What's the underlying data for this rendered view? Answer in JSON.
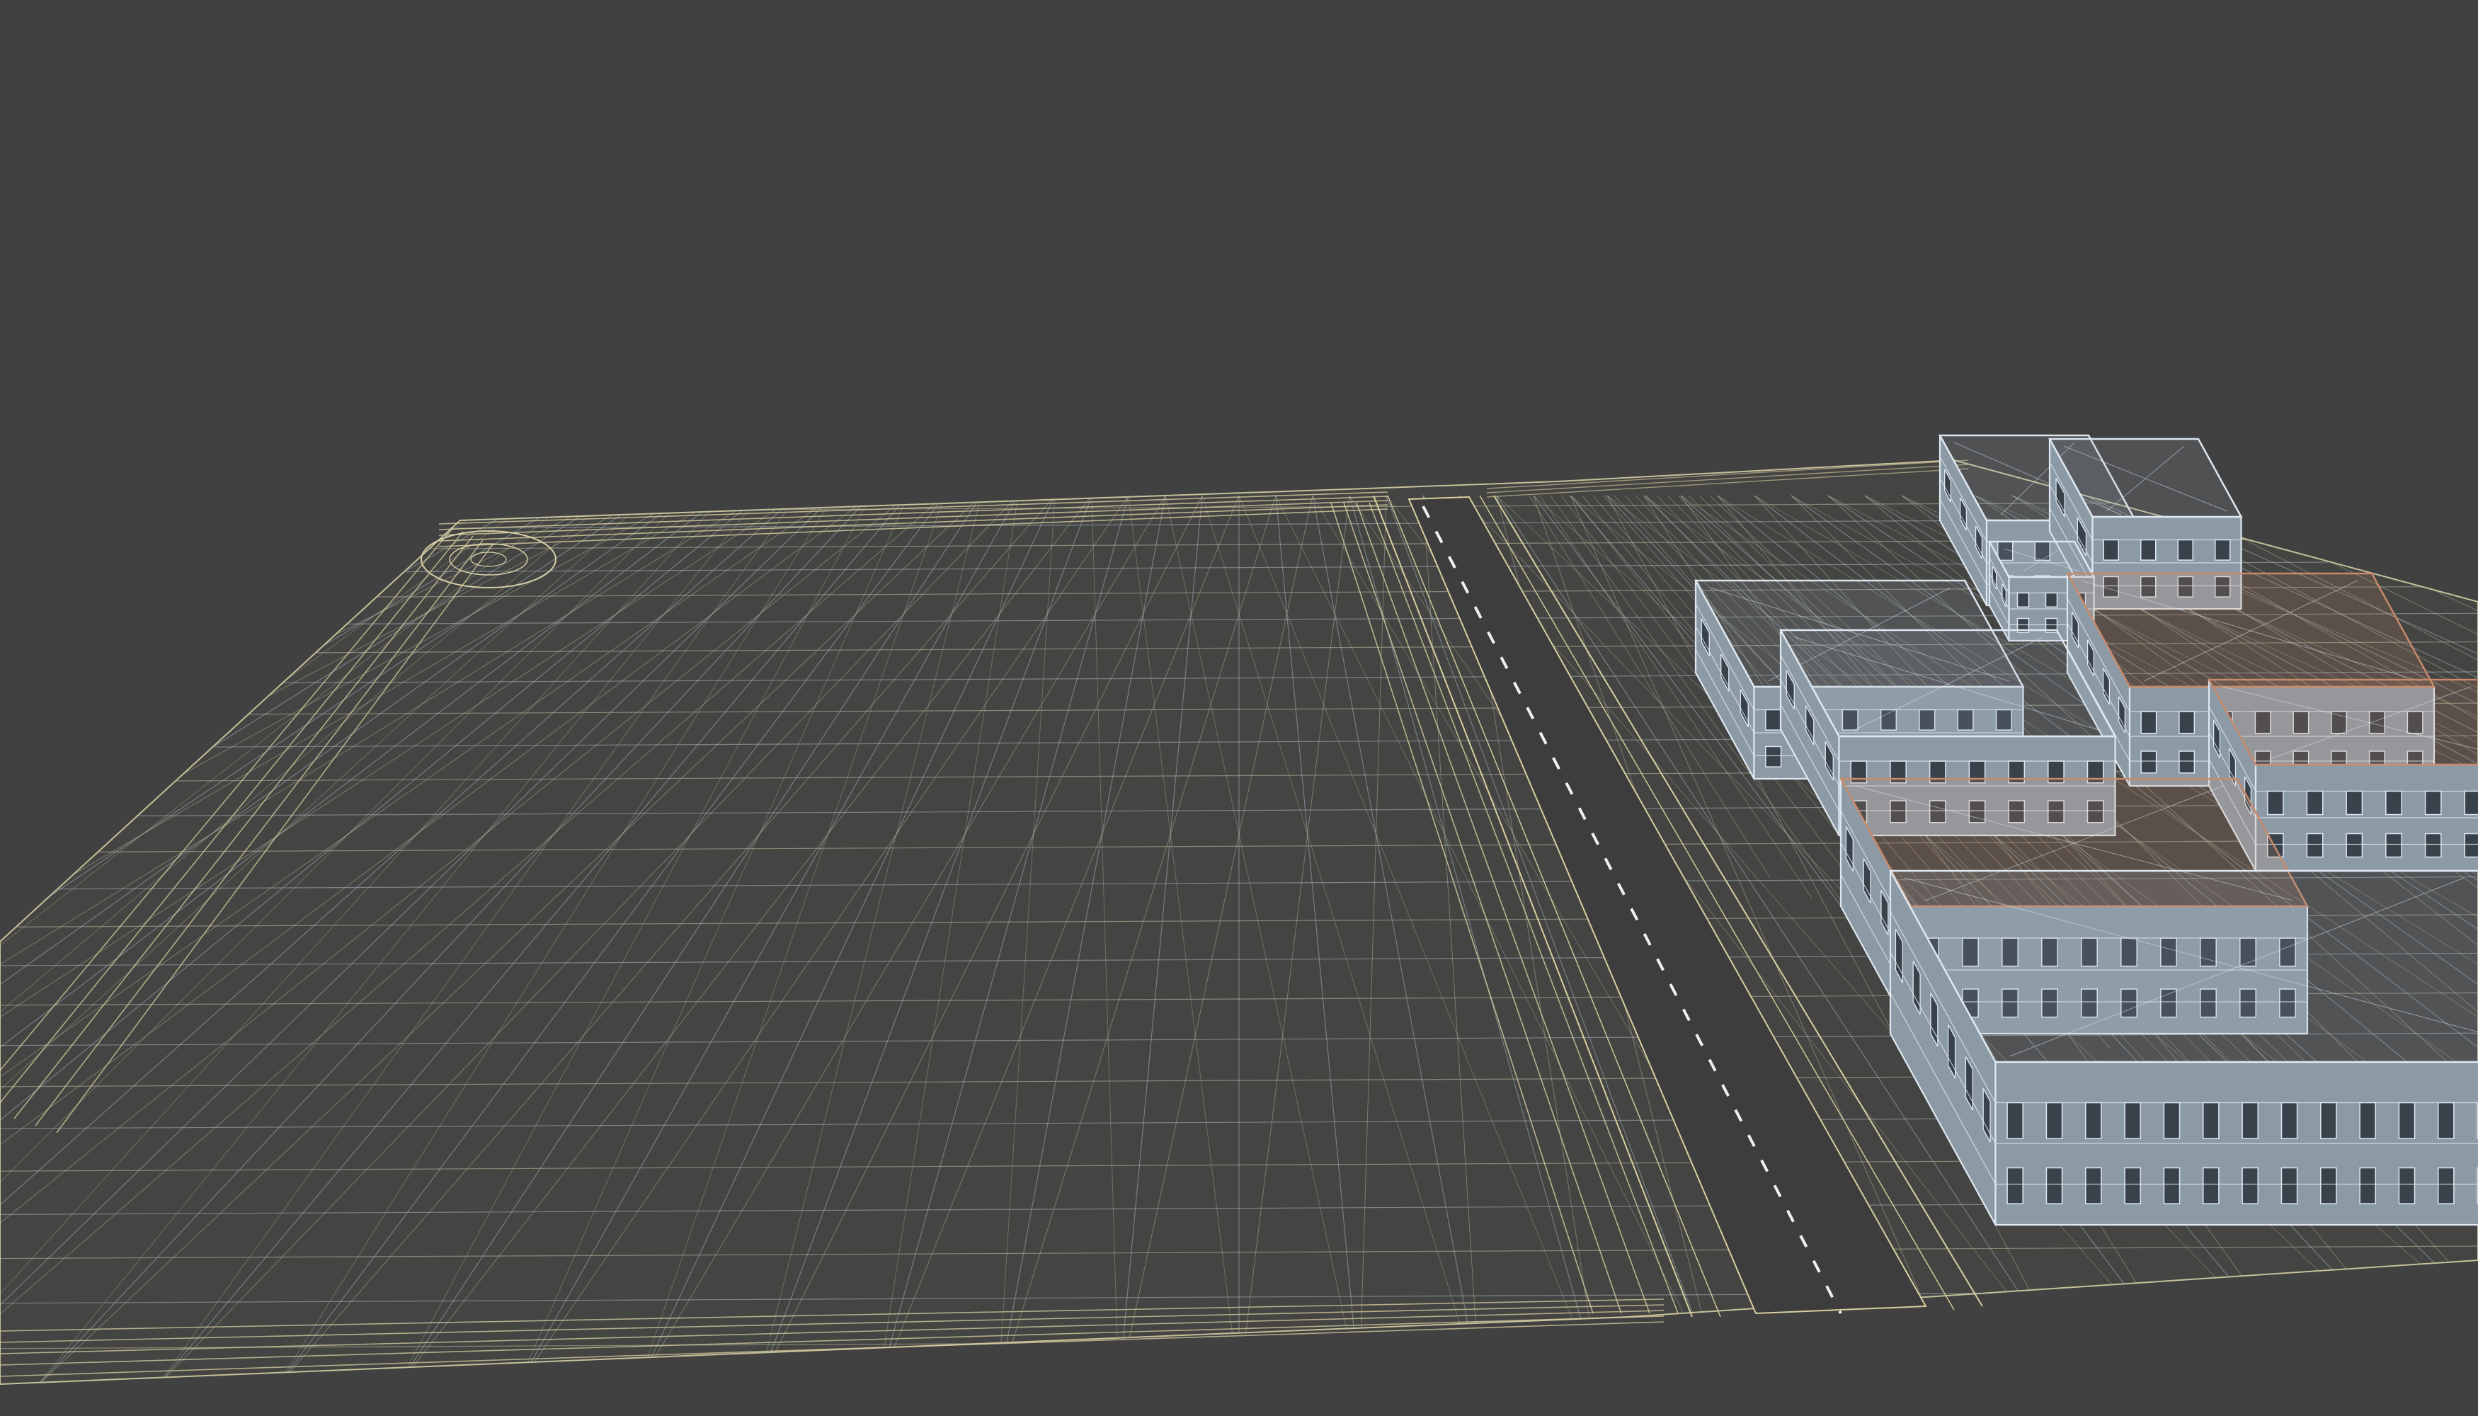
{
  "scene": {
    "background_color": "#414141",
    "render_mode": "wireframe",
    "colors": {
      "ground_wire": "#bfbfa0",
      "ground_wire_alt": "#a8b8c0",
      "edge_wire": "#d8cfa0",
      "road_dash": "#f2f2f2",
      "building_wire": "#dfe8f0",
      "building_fill": "#8c9aa6",
      "roof_accent": "#c88a6a"
    },
    "objects": [
      "terrain-plane",
      "road",
      "building-row-back",
      "building-row-middle",
      "building-block-front"
    ]
  }
}
